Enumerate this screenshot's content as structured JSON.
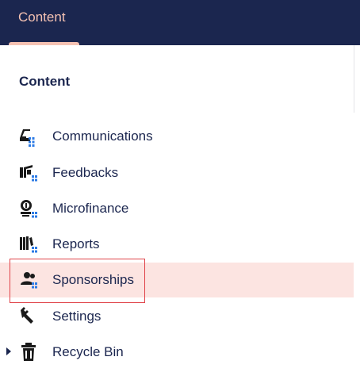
{
  "header": {
    "tab_label": "Content"
  },
  "tree": {
    "title": "Content",
    "items": [
      {
        "label": "Communications",
        "icon": "inbox-icon"
      },
      {
        "label": "Feedbacks",
        "icon": "feedback-icon"
      },
      {
        "label": "Microfinance",
        "icon": "coins-icon"
      },
      {
        "label": "Reports",
        "icon": "books-icon"
      },
      {
        "label": "Sponsorships",
        "icon": "users-icon",
        "selected": true
      },
      {
        "label": "Settings",
        "icon": "wrench-icon"
      },
      {
        "label": "Recycle Bin",
        "icon": "trash-icon",
        "expandable": true
      }
    ]
  },
  "colors": {
    "header_bg": "#1b264f",
    "tab_accent": "#f5c2b3",
    "selected_bg": "#fce4e1",
    "focus_outline": "#e0444a",
    "doc_type_badge": "#2d7be5"
  }
}
